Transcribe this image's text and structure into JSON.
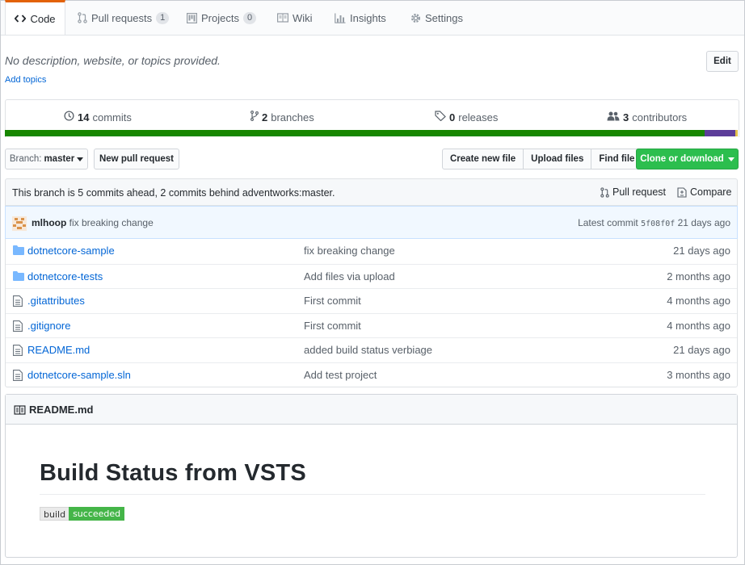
{
  "tabs": [
    {
      "label": "Code",
      "icon": "code-icon",
      "active": true
    },
    {
      "label": "Pull requests",
      "icon": "git-pull-request-icon",
      "count": "1"
    },
    {
      "label": "Projects",
      "icon": "project-icon",
      "count": "0"
    },
    {
      "label": "Wiki",
      "icon": "book-icon"
    },
    {
      "label": "Insights",
      "icon": "graph-icon"
    },
    {
      "label": "Settings",
      "icon": "gear-icon"
    }
  ],
  "repo": {
    "description": "No description, website, or topics provided.",
    "add_topics": "Add topics",
    "edit_label": "Edit"
  },
  "summary": {
    "commits_num": "14",
    "commits_label": "commits",
    "branches_num": "2",
    "branches_label": "branches",
    "releases_num": "0",
    "releases_label": "releases",
    "contributors_num": "3",
    "contributors_label": "contributors"
  },
  "language_bar": [
    {
      "color": "#178600",
      "share": 0.955
    },
    {
      "color": "#5c3d99",
      "share": 0.042
    },
    {
      "color": "#e1c04b",
      "share": 0.003
    }
  ],
  "toolbar": {
    "branch_prefix": "Branch:",
    "branch_name": "master",
    "new_pr": "New pull request",
    "create_file": "Create new file",
    "upload_files": "Upload files",
    "find_file": "Find file",
    "clone": "Clone or download"
  },
  "compare": {
    "text": "This branch is 5 commits ahead, 2 commits behind adventworks:master.",
    "pull_request": "Pull request",
    "compare": "Compare"
  },
  "commit": {
    "author": "mlhoop",
    "message": "fix breaking change",
    "latest_label": "Latest commit",
    "sha": "5f08f0f",
    "age": "21 days ago"
  },
  "files": [
    {
      "type": "dir",
      "name": "dotnetcore-sample",
      "message": "fix breaking change",
      "age": "21 days ago"
    },
    {
      "type": "dir",
      "name": "dotnetcore-tests",
      "message": "Add files via upload",
      "age": "2 months ago"
    },
    {
      "type": "file",
      "name": ".gitattributes",
      "message": "First commit",
      "age": "4 months ago"
    },
    {
      "type": "file",
      "name": ".gitignore",
      "message": "First commit",
      "age": "4 months ago"
    },
    {
      "type": "file",
      "name": "README.md",
      "message": "added build status verbiage",
      "age": "21 days ago"
    },
    {
      "type": "file",
      "name": "dotnetcore-sample.sln",
      "message": "Add test project",
      "age": "3 months ago"
    }
  ],
  "readme": {
    "title": "README.md",
    "heading": "Build Status from VSTS",
    "badge_label": "build",
    "badge_status": "succeeded"
  }
}
